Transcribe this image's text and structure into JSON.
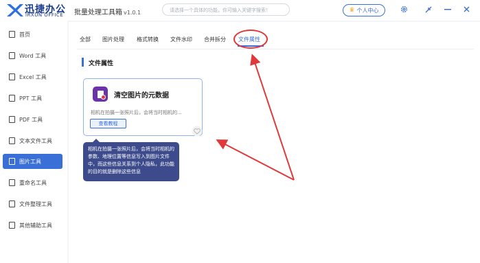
{
  "header": {
    "logo_cn": "迅捷办公",
    "logo_en": "IRXUN OFFICE",
    "app_title": "批量处理工具箱",
    "version": "v1.0.1",
    "search_placeholder": "请选择一个具体的功能，你可输入关键字搜索！",
    "user_center": "个人中心"
  },
  "sidebar": {
    "items": [
      {
        "label": "首页"
      },
      {
        "label": "Word 工具"
      },
      {
        "label": "Excel 工具"
      },
      {
        "label": "PPT 工具"
      },
      {
        "label": "PDF 工具"
      },
      {
        "label": "文本文件工具"
      },
      {
        "label": "图片工具"
      },
      {
        "label": "重命名工具"
      },
      {
        "label": "文件整理工具"
      },
      {
        "label": "其他辅助工具"
      }
    ],
    "active_index": 6
  },
  "tabs": [
    "全部",
    "图片处理",
    "格式转换",
    "文件水印",
    "合并拆分",
    "文件属性"
  ],
  "active_tab": "文件属性",
  "section_title": "文件属性",
  "card": {
    "title": "清空图片的元数据",
    "description": "相机在拍摄一张照片后，会将当时相机的...",
    "button_label": "查看教程"
  },
  "tooltip": {
    "text": "相机在拍摄一张照片后，会将当时相机的参数、地理位置等信息写入到图片文件中，而这些信息关系到个人隐私，此功能的目的就是删除这些信息"
  },
  "colors": {
    "accent": "#3a6fd8",
    "annotation": "#e0383b",
    "tooltip_bg": "#3d4b8c",
    "icon_bg": "#6a34a8"
  }
}
